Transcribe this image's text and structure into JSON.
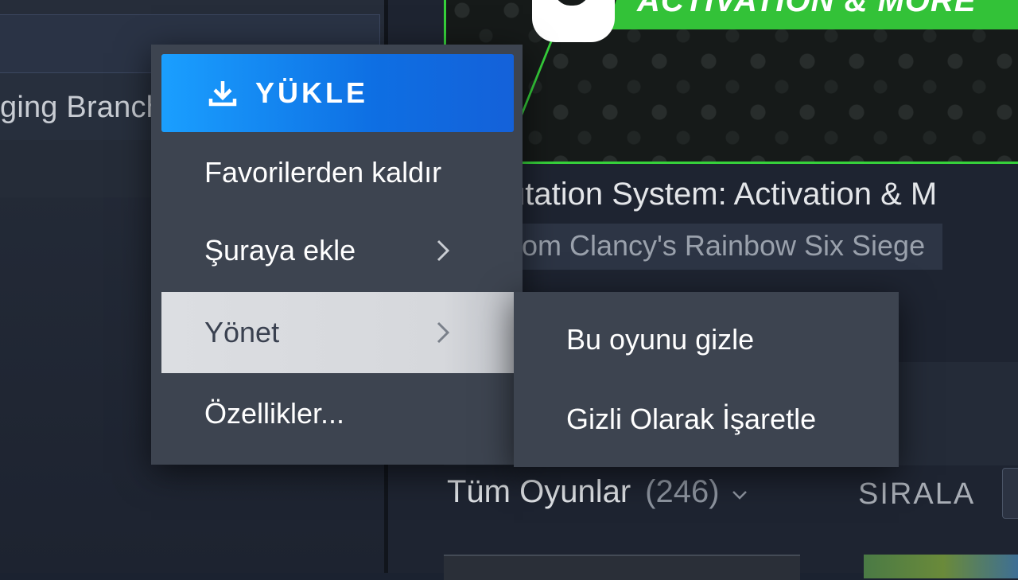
{
  "sidebar": {
    "partial_row_label": "ging Branch"
  },
  "banner": {
    "title": "ACTIVATION & MORE",
    "accent_color": "#36d13b"
  },
  "item": {
    "title": "utation System: Activation & M",
    "game_tag": "om Clancy's Rainbow Six Siege"
  },
  "library": {
    "all_games_label": "Tüm Oyunlar",
    "count": "(246)",
    "sort_label": "SIRALA"
  },
  "context_menu": {
    "install_label": "YÜKLE",
    "items": [
      {
        "label": "Favorilerden kaldır",
        "has_submenu": false
      },
      {
        "label": "Şuraya ekle",
        "has_submenu": true
      },
      {
        "label": "Yönet",
        "has_submenu": true,
        "active": true
      },
      {
        "label": "Özellikler...",
        "has_submenu": false
      }
    ]
  },
  "submenu": {
    "items": [
      {
        "label": "Bu oyunu gizle"
      },
      {
        "label": "Gizli Olarak İşaretle"
      }
    ]
  },
  "colors": {
    "install_button": "#1a9fff",
    "menu_bg": "#3d4450",
    "active_item_bg": "#dcdee2"
  }
}
